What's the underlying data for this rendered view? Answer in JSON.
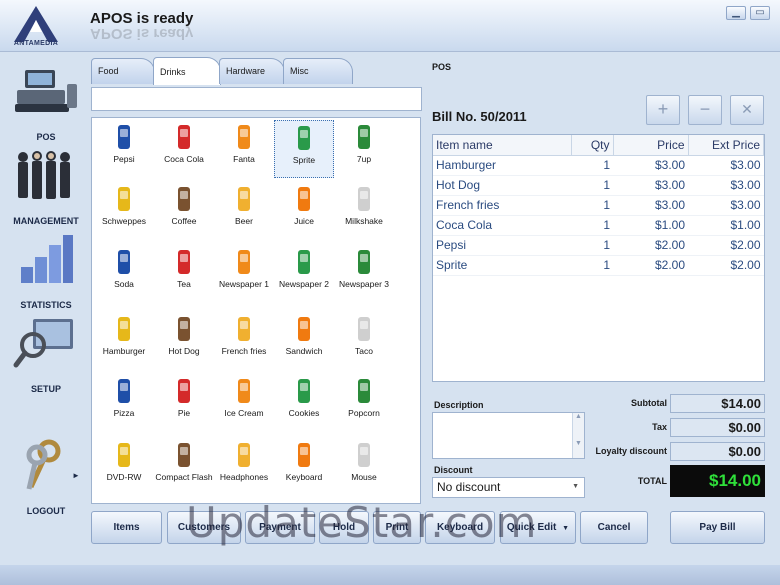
{
  "app": {
    "logo_text": "ANTAMEDIA",
    "title": "APOS is ready"
  },
  "nav": [
    {
      "label": "POS",
      "icon": "register-icon"
    },
    {
      "label": "MANAGEMENT",
      "icon": "people-icon"
    },
    {
      "label": "STATISTICS",
      "icon": "chart-icon"
    },
    {
      "label": "SETUP",
      "icon": "magnifier-icon"
    },
    {
      "label": "LOGOUT",
      "icon": "keys-icon"
    }
  ],
  "tabs": [
    "Food",
    "Drinks",
    "Hardware",
    "Misc"
  ],
  "products": [
    [
      "Pepsi",
      "Coca Cola",
      "Fanta",
      "Sprite",
      "7up"
    ],
    [
      "Schweppes",
      "Coffee",
      "Beer",
      "Juice",
      "Milkshake"
    ],
    [
      "Soda",
      "Tea",
      "Newspaper 1",
      "Newspaper 2",
      "Newspaper 3"
    ],
    [
      "Hamburger",
      "Hot Dog",
      "French fries",
      "Sandwich",
      "Taco"
    ],
    [
      "Pizza",
      "Pie",
      "Ice Cream",
      "Cookies",
      "Popcorn"
    ],
    [
      "DVD-RW",
      "Compact Flash",
      "Headphones",
      "Keyboard",
      "Mouse"
    ]
  ],
  "selected_product": "Sprite",
  "pos": {
    "section_label": "POS",
    "bill_no": "Bill No. 50/2011",
    "controls": {
      "add": "+",
      "remove": "−",
      "clear": "✕"
    },
    "columns": [
      "Item name",
      "Qty",
      "Price",
      "Ext Price"
    ],
    "rows": [
      [
        "Hamburger",
        "1",
        "$3.00",
        "$3.00"
      ],
      [
        "Hot Dog",
        "1",
        "$3.00",
        "$3.00"
      ],
      [
        "French fries",
        "1",
        "$3.00",
        "$3.00"
      ],
      [
        "Coca Cola",
        "1",
        "$1.00",
        "$1.00"
      ],
      [
        "Pepsi",
        "1",
        "$2.00",
        "$2.00"
      ],
      [
        "Sprite",
        "1",
        "$2.00",
        "$2.00"
      ]
    ],
    "description_label": "Description",
    "discount_label": "Discount",
    "discount_value": "No discount",
    "subtotal_label": "Subtotal",
    "subtotal": "$14.00",
    "tax_label": "Tax",
    "tax": "$0.00",
    "loyalty_label": "Loyalty discount",
    "loyalty": "$0.00",
    "total_label": "TOTAL",
    "total": "$14.00"
  },
  "buttons": [
    "Items",
    "Customers",
    "Payment",
    "Hold",
    "Print",
    "Keyboard",
    "Quick Edit",
    "Cancel",
    "Pay Bill"
  ],
  "watermark": "UpdateStar.com",
  "colors": {
    "total_text": "#2fe03a",
    "total_bg": "#0b0b0b",
    "accent": "#2a4b80"
  }
}
